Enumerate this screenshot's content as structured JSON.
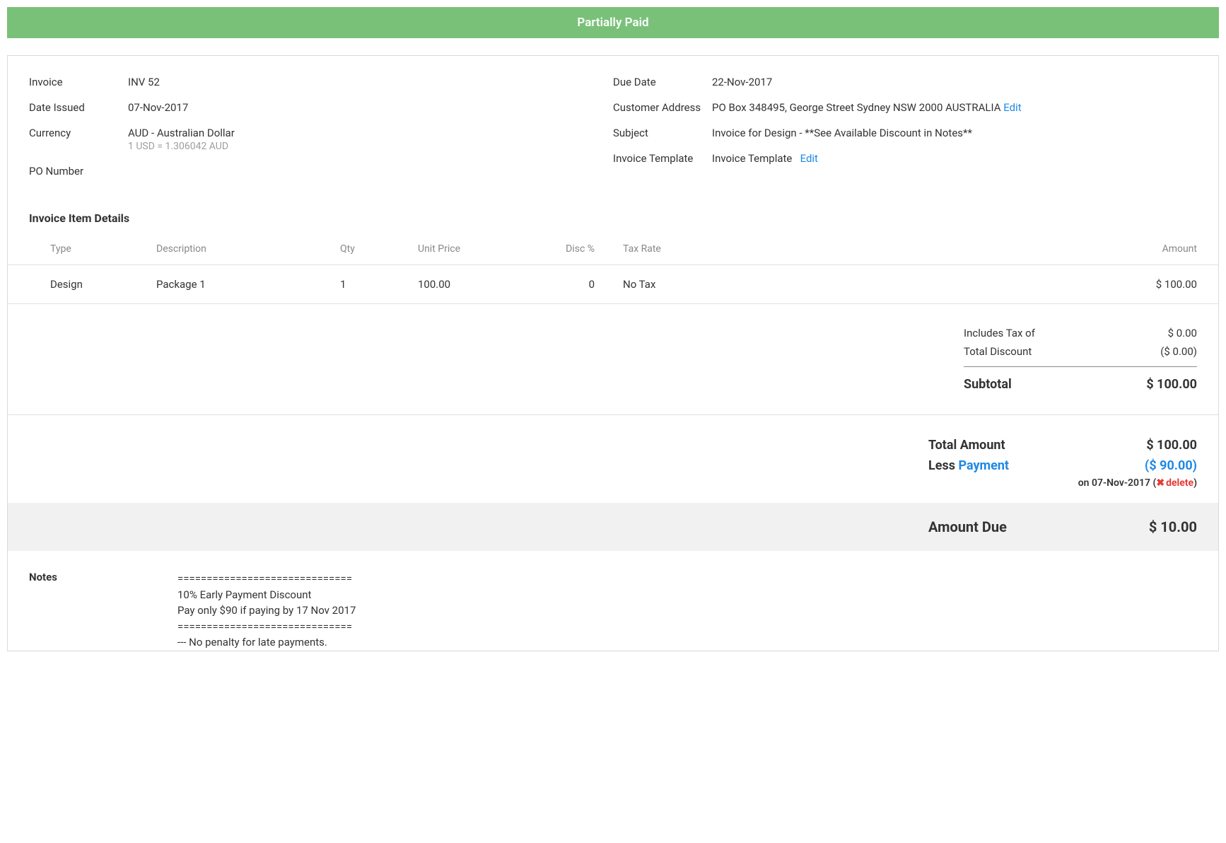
{
  "status_banner": "Partially Paid",
  "meta_left": {
    "invoice_label": "Invoice",
    "invoice_value": "INV 52",
    "date_issued_label": "Date Issued",
    "date_issued_value": "07-Nov-2017",
    "currency_label": "Currency",
    "currency_value": "AUD - Australian Dollar",
    "currency_sub": "1 USD = 1.306042 AUD",
    "po_label": "PO Number",
    "po_value": ""
  },
  "meta_right": {
    "due_date_label": "Due Date",
    "due_date_value": "22-Nov-2017",
    "cust_addr_label": "Customer Address",
    "cust_addr_value": "PO Box 348495, George Street Sydney NSW 2000 AUSTRALIA",
    "cust_addr_edit": "Edit",
    "subject_label": "Subject",
    "subject_value": "Invoice for Design - **See Available Discount in Notes**",
    "template_label": "Invoice Template",
    "template_value": "Invoice Template",
    "template_edit": "Edit"
  },
  "items_title": "Invoice Item Details",
  "items_headers": {
    "type": "Type",
    "desc": "Description",
    "qty": "Qty",
    "price": "Unit Price",
    "disc": "Disc %",
    "tax": "Tax Rate",
    "amount": "Amount"
  },
  "items": [
    {
      "type": "Design",
      "desc": "Package 1",
      "qty": "1",
      "price": "100.00",
      "disc": "0",
      "tax": "No Tax",
      "amount": "$ 100.00"
    }
  ],
  "totals": {
    "includes_tax_label": "Includes Tax of",
    "includes_tax_value": "$ 0.00",
    "total_discount_label": "Total Discount",
    "total_discount_value": "($ 0.00)",
    "subtotal_label": "Subtotal",
    "subtotal_value": "$ 100.00"
  },
  "grand": {
    "total_amount_label": "Total Amount",
    "total_amount_value": "$ 100.00",
    "less_text": "Less",
    "payment_link": "Payment",
    "less_payment_value": "($ 90.00)",
    "payment_on_prefix": "on ",
    "payment_on_date": "07-Nov-2017",
    "payment_paren_open": "  (",
    "payment_delete": "delete",
    "payment_paren_close": ")"
  },
  "amount_due": {
    "label": "Amount Due",
    "value": "$ 10.00"
  },
  "notes": {
    "label": "Notes",
    "body": "==============================\n10% Early Payment Discount\nPay only $90 if paying by 17 Nov 2017\n==============================\n--- No penalty for late payments."
  }
}
